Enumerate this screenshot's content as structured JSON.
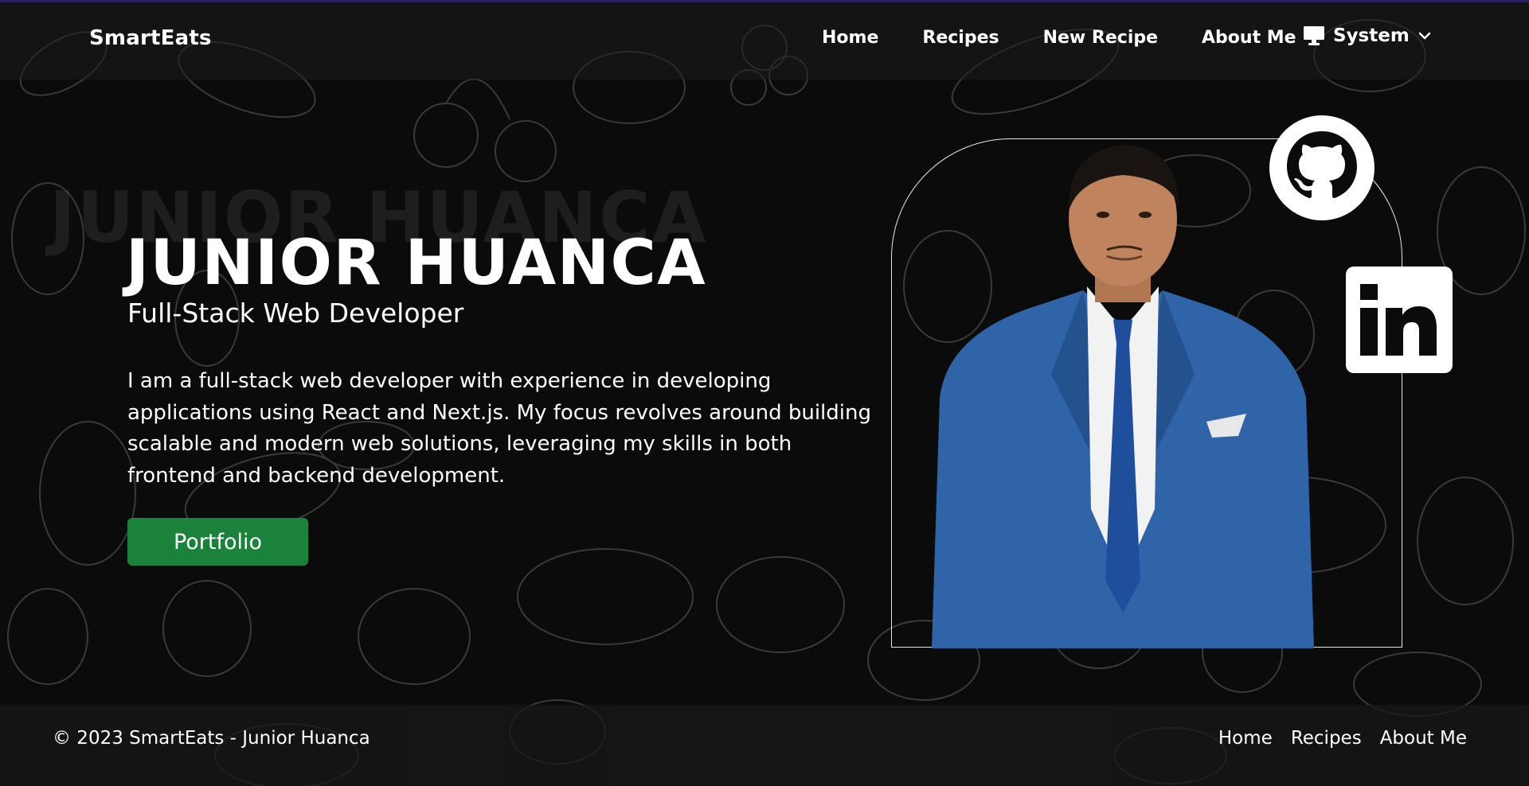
{
  "navbar": {
    "brand": "SmartEats",
    "links": [
      "Home",
      "Recipes",
      "New Recipe",
      "About Me"
    ],
    "theme": {
      "label": "System",
      "icon": "monitor-icon"
    }
  },
  "hero": {
    "ghost_name": "JUNIOR HUANCA",
    "name": "JUNIOR HUANCA",
    "role": "Full-Stack Web Developer",
    "bio": "I am a full-stack web developer with experience in developing applications using React and Next.js. My focus revolves around building scalable and modern web solutions, leveraging my skills in both frontend and backend development.",
    "portfolio_label": "Portfolio",
    "social": [
      "github-icon",
      "linkedin-icon"
    ]
  },
  "footer": {
    "copyright": "© 2023 SmartEats - Junior Huanca",
    "links": [
      "Home",
      "Recipes",
      "About Me"
    ]
  },
  "colors": {
    "background": "#0b0b0b",
    "button": "#1a823b",
    "suit": "#2f64a8"
  }
}
